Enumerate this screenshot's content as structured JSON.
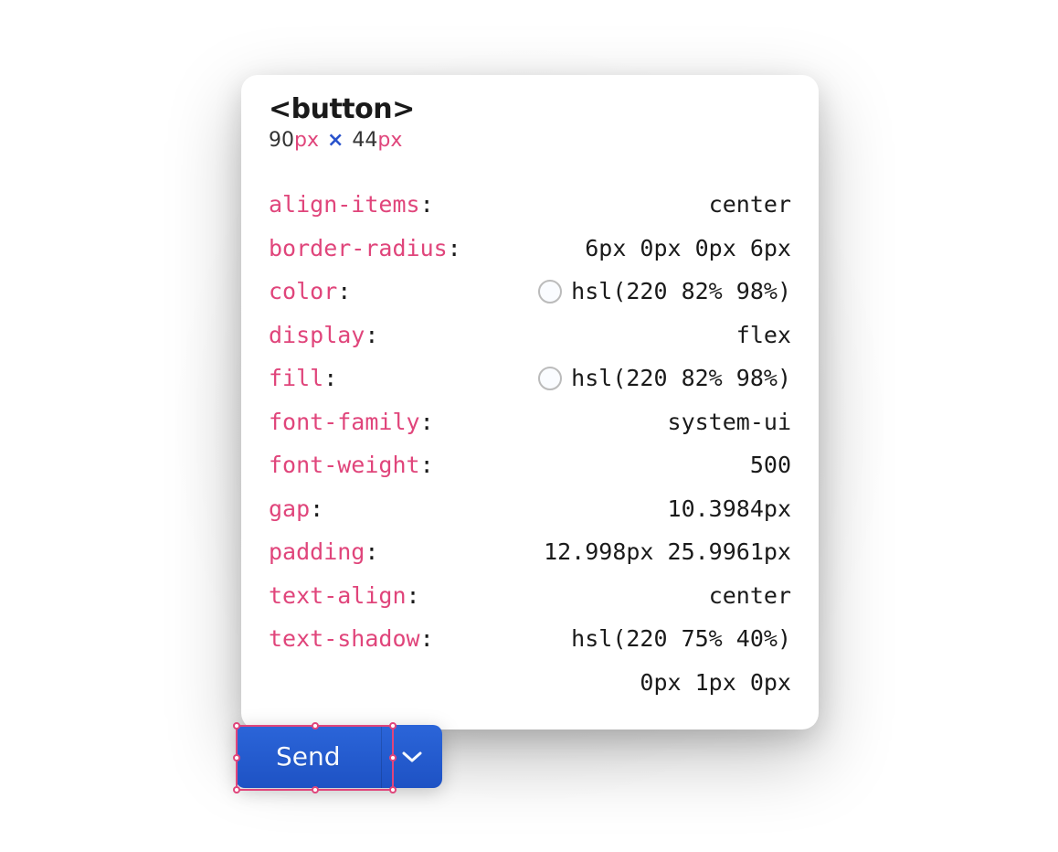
{
  "tooltip": {
    "tag": "<button>",
    "width": "90",
    "height": "44",
    "unit": "px",
    "separator": "×"
  },
  "properties": [
    {
      "name": "align-items",
      "value": "center",
      "swatch": false
    },
    {
      "name": "border-radius",
      "value": "6px 0px 0px 6px",
      "swatch": false
    },
    {
      "name": "color",
      "value": "hsl(220 82% 98%)",
      "swatch": true
    },
    {
      "name": "display",
      "value": "flex",
      "swatch": false
    },
    {
      "name": "fill",
      "value": "hsl(220 82% 98%)",
      "swatch": true
    },
    {
      "name": "font-family",
      "value": "system-ui",
      "swatch": false
    },
    {
      "name": "font-weight",
      "value": "500",
      "swatch": false
    },
    {
      "name": "gap",
      "value": "10.3984px",
      "swatch": false
    },
    {
      "name": "padding",
      "value": "12.998px 25.9961px",
      "swatch": false
    },
    {
      "name": "text-align",
      "value": "center",
      "swatch": false
    },
    {
      "name": "text-shadow",
      "value": "hsl(220 75% 40%)",
      "value2": "0px 1px 0px",
      "swatch": false
    }
  ],
  "button": {
    "label": "Send"
  }
}
